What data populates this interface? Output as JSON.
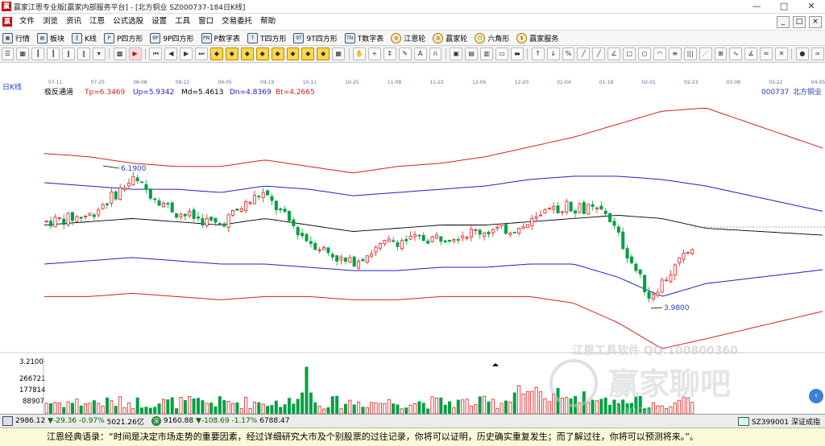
{
  "window": {
    "title": "赢家江恩专业版[赢家内部服务平台] - [北方铜业  SZ000737-184日K线]",
    "controls": [
      "—",
      "□",
      "✕"
    ]
  },
  "menu": {
    "items": [
      "文件",
      "浏览",
      "资讯",
      "江恩",
      "公式选股",
      "设置",
      "工具",
      "窗口",
      "交易委托",
      "帮助"
    ],
    "right_controls": [
      "_",
      "□",
      "×"
    ]
  },
  "toolbar": {
    "items": [
      {
        "label": "行情",
        "icon": "grid-icon"
      },
      {
        "label": "板块",
        "icon": "blocks-icon"
      },
      {
        "label": "K线",
        "icon": "candlestick-icon"
      },
      {
        "label": "P四方形",
        "icon": "square-p-icon"
      },
      {
        "label": "9P四方形",
        "icon": "square-9p-icon"
      },
      {
        "label": "P数字表",
        "icon": "table-p-icon"
      },
      {
        "label": "T四方形",
        "icon": "square-t-icon"
      },
      {
        "label": "9T四方形",
        "icon": "square-9t-icon"
      },
      {
        "label": "T数字表",
        "icon": "table-t-icon"
      },
      {
        "label": "江恩轮",
        "icon": "wheel-icon"
      },
      {
        "label": "赢家轮",
        "icon": "wheel-icon"
      },
      {
        "label": "六角形",
        "icon": "hexagon-icon"
      },
      {
        "label": "赢家服务",
        "icon": "dollar-icon"
      }
    ]
  },
  "chart": {
    "period_label": "日K线",
    "indicator": {
      "name": "极反通道",
      "tp": "Tp=6.3469",
      "up": "Up=5.9342",
      "md": "Md=5.4613",
      "dn": "Dn=4.8369",
      "bt": "Bt=4.2665"
    },
    "stock_code": "000737",
    "stock_name": "北方铜业",
    "date_ticks": [
      "07-11",
      "07-25",
      "08-08",
      "08-22",
      "09-05",
      "09-19",
      "10-11",
      "10-25",
      "11-08",
      "11-22",
      "12-06",
      "12-20",
      "01-04",
      "01-18",
      "02-01",
      "02-23",
      "03-08",
      "03-22",
      "04-05"
    ],
    "high_label": "6.1900",
    "low_label": "3.9800",
    "volume": {
      "max_label": "3.2100",
      "ticks": [
        "266721",
        "177814",
        "88907"
      ]
    },
    "watermark": {
      "line1": "江恩工具软件  QQ:100800360",
      "logo_text": "赢家聊吧",
      "url": "liaoba.y..."
    },
    "colors": {
      "up_candle": "#e21c1c",
      "down_candle": "#00a040",
      "outer_band": "#d42020",
      "inner_band": "#2020c0",
      "mid_line": "#000000"
    }
  },
  "chart_data": {
    "type": "candlestick",
    "x": [
      "07-11",
      "07-25",
      "08-08",
      "08-22",
      "09-05",
      "09-19",
      "10-11",
      "10-25",
      "11-08",
      "11-22",
      "12-06",
      "12-20",
      "01-04",
      "01-18",
      "02-01",
      "02-23"
    ],
    "close": [
      5.45,
      5.55,
      6.1,
      5.6,
      5.4,
      5.9,
      5.2,
      4.8,
      5.15,
      5.2,
      5.3,
      5.35,
      5.7,
      5.6,
      4.3,
      5.05
    ],
    "series": [
      {
        "name": "Tp",
        "values": [
          6.5,
          6.45,
          6.35,
          6.3,
          6.3,
          6.4,
          6.3,
          6.2,
          6.3,
          6.35,
          6.45,
          6.6,
          6.75,
          6.95,
          7.15,
          7.2
        ]
      },
      {
        "name": "Up",
        "values": [
          6.05,
          6.0,
          5.95,
          5.95,
          5.9,
          6.0,
          5.95,
          5.85,
          5.9,
          5.95,
          6.0,
          6.1,
          6.15,
          6.15,
          6.1,
          6.0
        ]
      },
      {
        "name": "Md",
        "values": [
          5.4,
          5.45,
          5.5,
          5.45,
          5.4,
          5.5,
          5.4,
          5.3,
          5.35,
          5.4,
          5.4,
          5.45,
          5.5,
          5.55,
          5.5,
          5.35
        ]
      },
      {
        "name": "Dn",
        "values": [
          4.8,
          4.85,
          4.9,
          4.85,
          4.8,
          4.8,
          4.75,
          4.7,
          4.7,
          4.75,
          4.75,
          4.8,
          4.8,
          4.6,
          4.3,
          4.5
        ]
      },
      {
        "name": "Bt",
        "values": [
          4.3,
          4.3,
          4.35,
          4.3,
          4.25,
          4.3,
          4.3,
          4.25,
          4.25,
          4.3,
          4.3,
          4.3,
          4.2,
          3.9,
          3.5,
          3.65
        ]
      }
    ],
    "high_marker": 6.19,
    "low_marker": 3.98,
    "ylim": [
      3.5,
      7.3
    ]
  },
  "status": {
    "sh_index": "2986.12",
    "sh_change": "▼-29.36",
    "sh_pct": "-0.97%",
    "sh_amount": "5021.26亿",
    "sz_index": "9160.88",
    "sz_change": "▼-108.69",
    "sz_pct": "-1.17%",
    "sz_amount": "6788.47",
    "right_text": "SZ399001 深证成指"
  },
  "quote": {
    "text": "江恩经典语录：“时间是决定市场走势的重要因素，经过详细研究大市及个别股票的过往记录，你将可以证明，历史确实重复发生；而了解过往，你将可以预测将来。”。"
  }
}
